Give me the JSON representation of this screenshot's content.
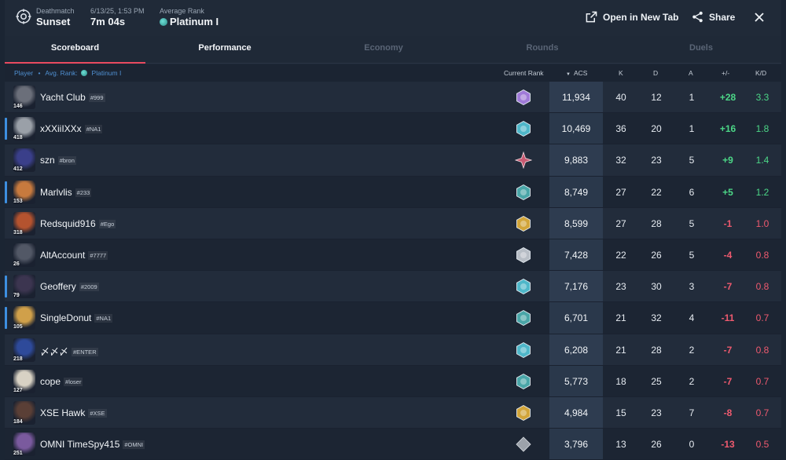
{
  "header": {
    "mode_label": "Deathmatch",
    "map": "Sunset",
    "date": "6/13/25, 1:53 PM",
    "duration": "7m 04s",
    "avg_rank_label": "Average Rank",
    "avg_rank": "Platinum I",
    "open_label": "Open in New Tab",
    "share_label": "Share"
  },
  "tabs": [
    "Scoreboard",
    "Performance",
    "Economy",
    "Rounds",
    "Duels"
  ],
  "table_header": {
    "player": "Player",
    "dot": "•",
    "avg_rank_prefix": "Avg. Rank:",
    "avg_rank": "Platinum I",
    "current_rank": "Current Rank",
    "acs": "ACS",
    "k": "K",
    "d": "D",
    "a": "A",
    "pm": "+/-",
    "kd": "K/D"
  },
  "players": [
    {
      "name": "Yacht Club",
      "tag": "#999",
      "level": "146",
      "rank_icon": "ascendant-rank-icon",
      "rank_color": "#a07bd8",
      "acs": "11,934",
      "k": "40",
      "d": "12",
      "a": "1",
      "pm": "+28",
      "kd": "3.3",
      "teambar": false,
      "avatar_color": "#6b6f7a"
    },
    {
      "name": "xXXiiIXXx",
      "tag": "#NA1",
      "level": "418",
      "rank_icon": "diamond-rank-icon",
      "rank_color": "#4fb7c9",
      "acs": "10,469",
      "k": "36",
      "d": "20",
      "a": "1",
      "pm": "+16",
      "kd": "1.8",
      "teambar": true,
      "avatar_color": "#9aa0a8"
    },
    {
      "name": "szn",
      "tag": "#bron",
      "level": "412",
      "rank_icon": "immortal-rank-icon",
      "rank_color": "#c85a72",
      "acs": "9,883",
      "k": "32",
      "d": "23",
      "a": "5",
      "pm": "+9",
      "kd": "1.4",
      "teambar": false,
      "avatar_color": "#3a3f8a"
    },
    {
      "name": "Marlvlis",
      "tag": "#233",
      "level": "153",
      "rank_icon": "platinum-rank-icon",
      "rank_color": "#4aa6a8",
      "acs": "8,749",
      "k": "27",
      "d": "22",
      "a": "6",
      "pm": "+5",
      "kd": "1.2",
      "teambar": true,
      "avatar_color": "#c77a3e"
    },
    {
      "name": "Redsquid916",
      "tag": "#Ego",
      "level": "318",
      "rank_icon": "gold-rank-icon",
      "rank_color": "#d2a53a",
      "acs": "8,599",
      "k": "27",
      "d": "28",
      "a": "5",
      "pm": "-1",
      "kd": "1.0",
      "teambar": false,
      "avatar_color": "#b4532f"
    },
    {
      "name": "AltAccount",
      "tag": "#7777",
      "level": "26",
      "rank_icon": "silver-rank-icon",
      "rank_color": "#b8bec6",
      "acs": "7,428",
      "k": "22",
      "d": "26",
      "a": "5",
      "pm": "-4",
      "kd": "0.8",
      "teambar": false,
      "avatar_color": "#525866"
    },
    {
      "name": "Geoffery",
      "tag": "#2009",
      "level": "79",
      "rank_icon": "platinum-rank-icon",
      "rank_color": "#4fb7c9",
      "acs": "7,176",
      "k": "23",
      "d": "30",
      "a": "3",
      "pm": "-7",
      "kd": "0.8",
      "teambar": true,
      "avatar_color": "#3c3550"
    },
    {
      "name": "SingleDonut",
      "tag": "#NA1",
      "level": "105",
      "rank_icon": "platinum-rank-icon",
      "rank_color": "#4aa6a8",
      "acs": "6,701",
      "k": "21",
      "d": "32",
      "a": "4",
      "pm": "-11",
      "kd": "0.7",
      "teambar": true,
      "avatar_color": "#d0a04a"
    },
    {
      "name": "〆〆〆",
      "tag": "#ENTER",
      "level": "218",
      "rank_icon": "diamond-rank-icon",
      "rank_color": "#4fb7c9",
      "acs": "6,208",
      "k": "21",
      "d": "28",
      "a": "2",
      "pm": "-7",
      "kd": "0.8",
      "teambar": false,
      "avatar_color": "#2e4a9a"
    },
    {
      "name": "cope",
      "tag": "#loser",
      "level": "127",
      "rank_icon": "platinum-rank-icon",
      "rank_color": "#4aa6a8",
      "acs": "5,773",
      "k": "18",
      "d": "25",
      "a": "2",
      "pm": "-7",
      "kd": "0.7",
      "teambar": false,
      "avatar_color": "#d8d2c4"
    },
    {
      "name": "XSE Hawk",
      "tag": "#XSE",
      "level": "184",
      "rank_icon": "gold-rank-icon",
      "rank_color": "#d2a53a",
      "acs": "4,984",
      "k": "15",
      "d": "23",
      "a": "7",
      "pm": "-8",
      "kd": "0.7",
      "teambar": false,
      "avatar_color": "#5a3f36"
    },
    {
      "name": "OMNI TimeSpy415",
      "tag": "#OMNI",
      "level": "251",
      "rank_icon": "iron-rank-icon",
      "rank_color": "#9ca2aa",
      "acs": "3,796",
      "k": "13",
      "d": "26",
      "a": "0",
      "pm": "-13",
      "kd": "0.5",
      "teambar": false,
      "avatar_color": "#7a5a9e"
    }
  ]
}
